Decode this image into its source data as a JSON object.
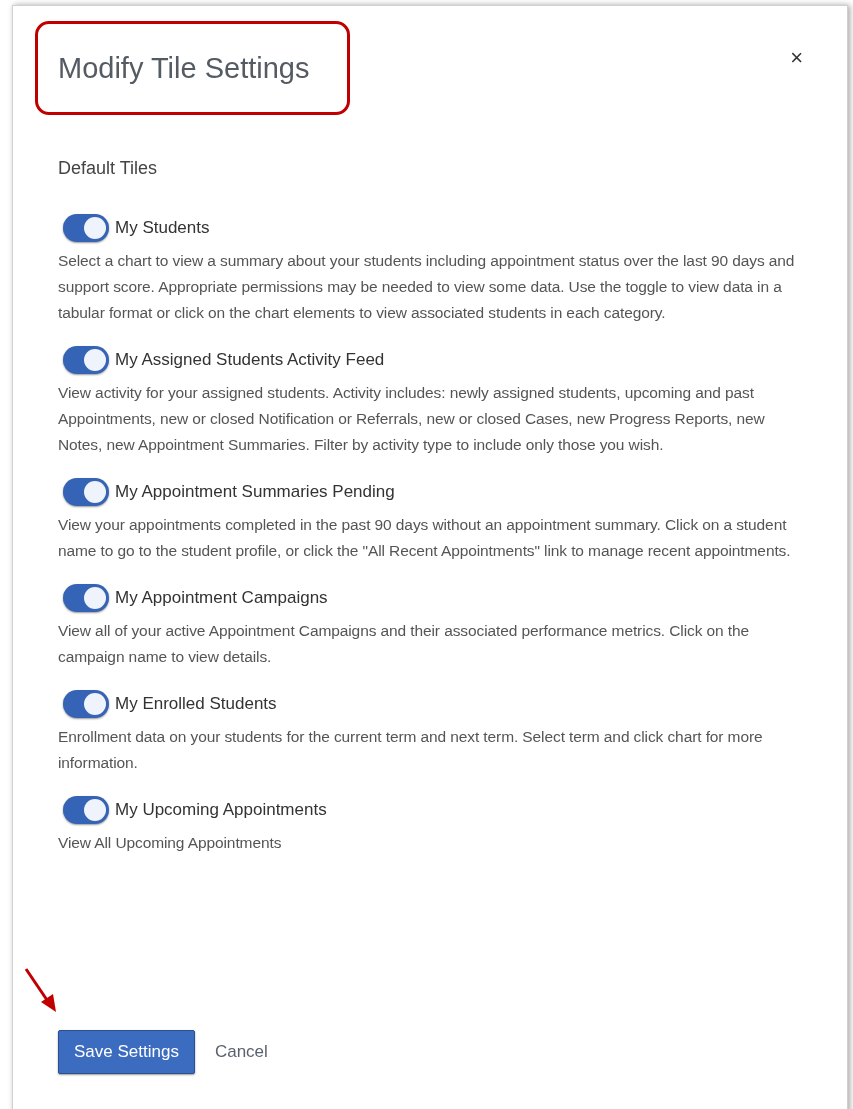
{
  "dialog": {
    "title": "Modify Tile Settings",
    "close": "×"
  },
  "section_label": "Default Tiles",
  "tiles": [
    {
      "name": "My Students",
      "on": true,
      "description": "Select a chart to view a summary about your students including appointment status over the last 90 days and support score. Appropriate permissions may be needed to view some data. Use the toggle to view data in a tabular format or click on the chart elements to view associated students in each category."
    },
    {
      "name": "My Assigned Students Activity Feed",
      "on": true,
      "description": "View activity for your assigned students. Activity includes: newly assigned students, upcoming and past Appointments, new or closed Notification or Referrals, new or closed Cases, new Progress Reports, new Notes, new Appointment Summaries. Filter by activity type to include only those you wish."
    },
    {
      "name": "My Appointment Summaries Pending",
      "on": true,
      "description": "View your appointments completed in the past 90 days without an appointment summary. Click on a student name to go to the student profile, or click the \"All Recent Appointments\" link to manage recent appointments."
    },
    {
      "name": "My Appointment Campaigns",
      "on": true,
      "description": "View all of your active Appointment Campaigns and their associated performance metrics. Click on the campaign name to view details."
    },
    {
      "name": "My Enrolled Students",
      "on": true,
      "description": "Enrollment data on your students for the current term and next term. Select term and click chart for more information."
    },
    {
      "name": "My Upcoming Appointments",
      "on": true,
      "description": "View All Upcoming Appointments"
    }
  ],
  "buttons": {
    "save": "Save Settings",
    "cancel": "Cancel"
  }
}
